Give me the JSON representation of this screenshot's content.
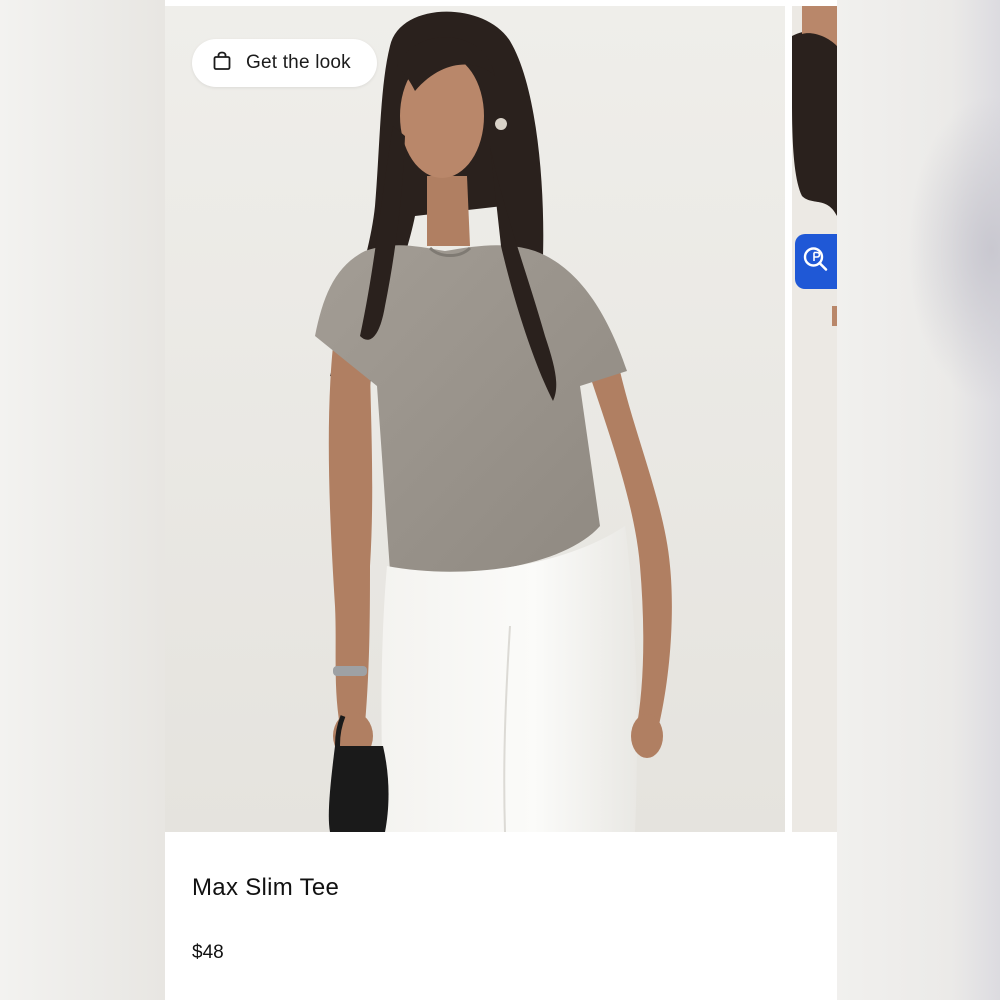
{
  "card": {
    "get_look_label": "Get the look",
    "product_title": "Max Slim Tee",
    "product_price": "$48"
  },
  "icons": {
    "bag": "shopping-bag-icon",
    "lens": "visual-search-icon"
  },
  "colors": {
    "lens_button": "#1f58d6",
    "pill_background": "#ffffff",
    "text": "#111111"
  }
}
